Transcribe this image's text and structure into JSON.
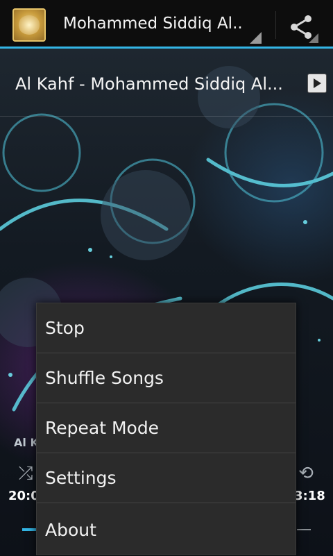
{
  "app_bar": {
    "title": "Mohammed Siddiq Al..",
    "logo_icon": "quran-seal-logo",
    "share_icon": "share-icon"
  },
  "now_playing": {
    "title": "Al Kahf - Mohammed Siddiq Al...",
    "play_icon": "play-icon"
  },
  "player": {
    "track_label_partial": "Al K",
    "elapsed": "20:0",
    "duration": "3:18",
    "shuffle_icon": "shuffle-icon",
    "repeat_icon": "repeat-icon"
  },
  "menu": {
    "items": [
      {
        "label": "Stop"
      },
      {
        "label": "Shuffle Songs"
      },
      {
        "label": "Repeat Mode"
      },
      {
        "label": "Settings"
      },
      {
        "label": "About"
      }
    ]
  },
  "colors": {
    "accent": "#33b5e5",
    "menu_bg": "#2b2b2b"
  }
}
